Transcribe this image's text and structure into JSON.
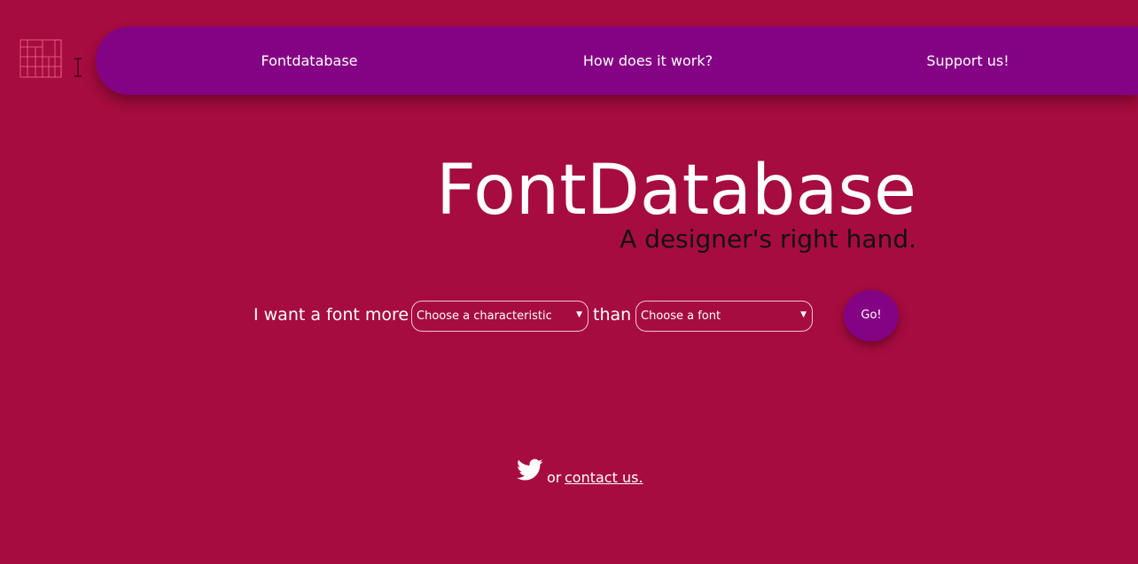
{
  "nav": {
    "items": [
      {
        "label": "Fontdatabase"
      },
      {
        "label": "How does it work?"
      },
      {
        "label": "Support us!"
      }
    ]
  },
  "hero": {
    "title": "FontDatabase",
    "subtitle": "A designer's right hand."
  },
  "search": {
    "prefix": "I want a font more",
    "characteristic_select": {
      "value": "Choose a characteristic"
    },
    "connector": "than",
    "font_select": {
      "value": "Choose a font"
    },
    "go_label": "Go!"
  },
  "footer": {
    "twitter_icon": "twitter-bird-icon",
    "or_text": "or",
    "contact_link": "contact us."
  },
  "colors": {
    "background": "#a60c3f",
    "nav_background": "#840384",
    "button_background": "#840384",
    "text_light": "#ffffff",
    "text_dark": "#111111"
  },
  "icons": {
    "logo": "fd-grid-logo-icon",
    "dropdown": "triangle-down-icon"
  }
}
